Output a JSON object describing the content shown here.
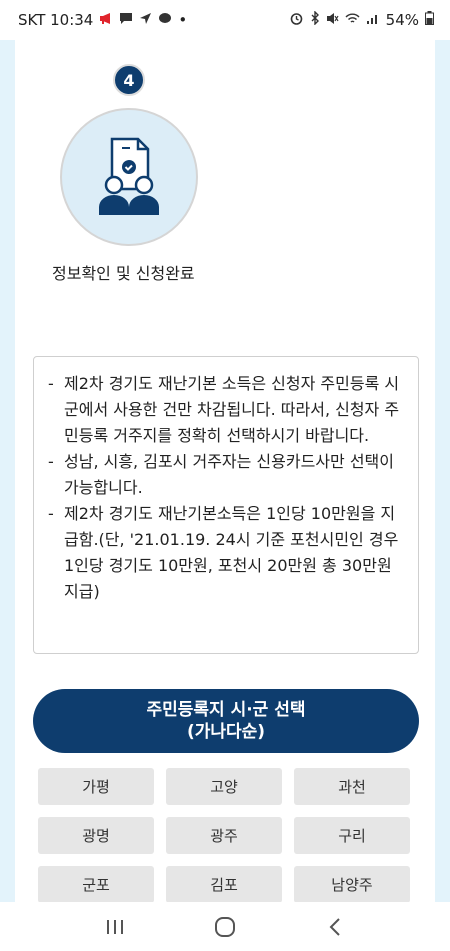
{
  "status_bar": {
    "carrier_time": "SKT 10:34",
    "dot": "•",
    "battery": "54%"
  },
  "step": {
    "number": "4",
    "label": "정보확인 및 신청완료",
    "icon": "document-check-users-icon"
  },
  "notice": {
    "items": [
      "제2차 경기도 재난기본 소득은 신청자 주민등록 시군에서 사용한 건만 차감됩니다. 따라서, 신청자 주민등록 거주지를 정확히 선택하시기 바랍니다.",
      "성남, 시흥, 김포시 거주자는 신용카드사만 선택이 가능합니다.",
      "제2차 경기도 재난기본소득은 1인당 10만원을 지급함.(단, '21.01.19. 24시 기준 포천시민인 경우 1인당 경기도 10만원, 포천시 20만원 총 30만원 지급)"
    ]
  },
  "select_button": {
    "line1": "주민등록지 시·군 선택",
    "line2": "(가나다순)"
  },
  "cities": [
    "가평",
    "고양",
    "과천",
    "광명",
    "광주",
    "구리",
    "군포",
    "김포",
    "남양주"
  ],
  "colors": {
    "primary": "#0e3d6e",
    "frame_bg": "#e3f3fb",
    "city_btn_bg": "#e6e6e6"
  }
}
